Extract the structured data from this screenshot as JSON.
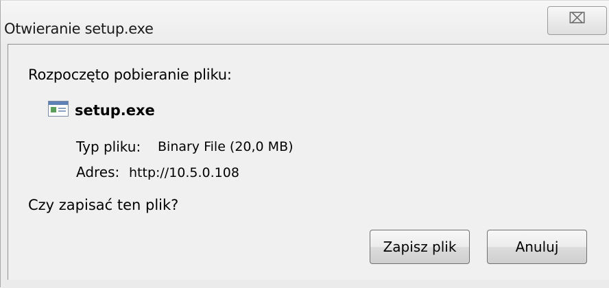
{
  "window": {
    "title": "Otwieranie setup.exe",
    "close_glyph": "⌧"
  },
  "dialog": {
    "heading": "Rozpoczęto pobieranie pliku:",
    "file": {
      "icon": "exe-file-icon",
      "name": "setup.exe"
    },
    "details": {
      "type_label": "Typ pliku:",
      "type_value": "Binary File (20,0 MB)",
      "address_label": "Adres:",
      "address_value": "http://10.5.0.108"
    },
    "question": "Czy zapisać ten plik?",
    "buttons": {
      "save_label": "Zapisz plik",
      "cancel_label": "Anuluj"
    }
  },
  "colors": {
    "dialog_background": "#f0f0f0",
    "frame_background": "#ebebeb",
    "button_border": "#707070"
  }
}
